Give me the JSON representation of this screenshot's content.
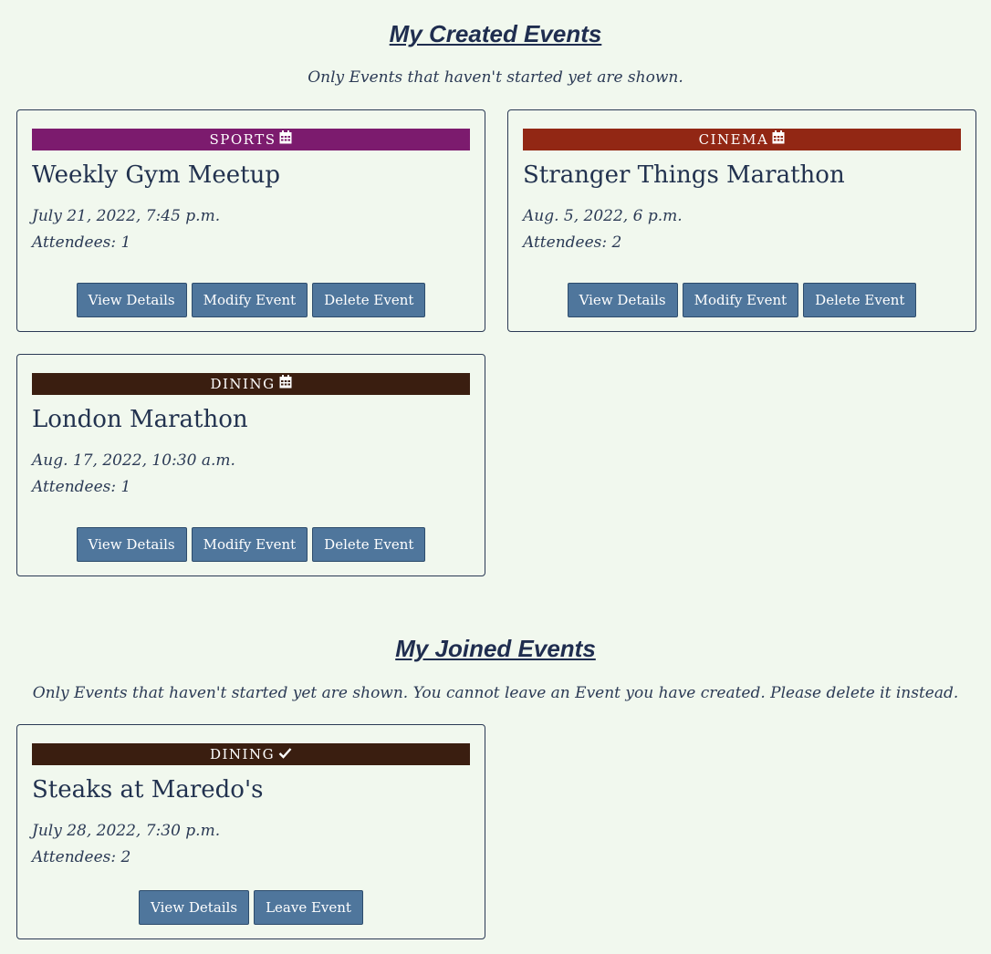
{
  "created": {
    "title": "My Created Events",
    "note": "Only Events that haven't started yet are shown.",
    "events": [
      {
        "category": "SPORTS",
        "category_icon": "calendar-icon",
        "category_color": "#7c1b6e",
        "title": "Weekly Gym Meetup",
        "date": "July 21, 2022, 7:45 p.m.",
        "attendees": "Attendees: 1",
        "buttons": [
          "View Details",
          "Modify Event",
          "Delete Event"
        ]
      },
      {
        "category": "CINEMA",
        "category_icon": "calendar-icon",
        "category_color": "#922714",
        "title": "Stranger Things Marathon",
        "date": "Aug. 5, 2022, 6 p.m.",
        "attendees": "Attendees: 2",
        "buttons": [
          "View Details",
          "Modify Event",
          "Delete Event"
        ]
      },
      {
        "category": "DINING",
        "category_icon": "calendar-icon",
        "category_color": "#3a1e10",
        "title": "London Marathon",
        "date": "Aug. 17, 2022, 10:30 a.m.",
        "attendees": "Attendees: 1",
        "buttons": [
          "View Details",
          "Modify Event",
          "Delete Event"
        ]
      }
    ]
  },
  "joined": {
    "title": "My Joined Events",
    "note": "Only Events that haven't started yet are shown. You cannot leave an Event you have created. Please delete it instead.",
    "events": [
      {
        "category": "DINING",
        "category_icon": "check-icon",
        "category_color": "#3a1e10",
        "title": "Steaks at Maredo's",
        "date": "July 28, 2022, 7:30 p.m.",
        "attendees": "Attendees: 2",
        "buttons": [
          "View Details",
          "Leave Event"
        ]
      }
    ]
  }
}
